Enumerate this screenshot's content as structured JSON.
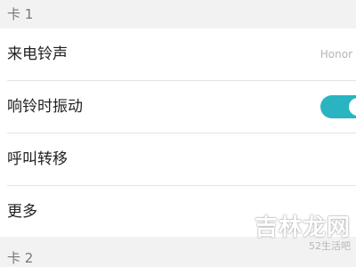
{
  "sections": {
    "sim1_header": "卡 1",
    "sim2_header": "卡 2"
  },
  "rows": {
    "ringtone": {
      "label": "来电铃声",
      "value": "Honor"
    },
    "vibrate": {
      "label": "响铃时振动",
      "toggle_on": true
    },
    "forwarding": {
      "label": "呼叫转移"
    },
    "more": {
      "label": "更多"
    }
  },
  "watermark": {
    "main": "吉林龙网",
    "sub": "52生活吧"
  },
  "colors": {
    "accent": "#2ab4c2",
    "background": "#f2f2f2",
    "row_background": "#ffffff"
  }
}
